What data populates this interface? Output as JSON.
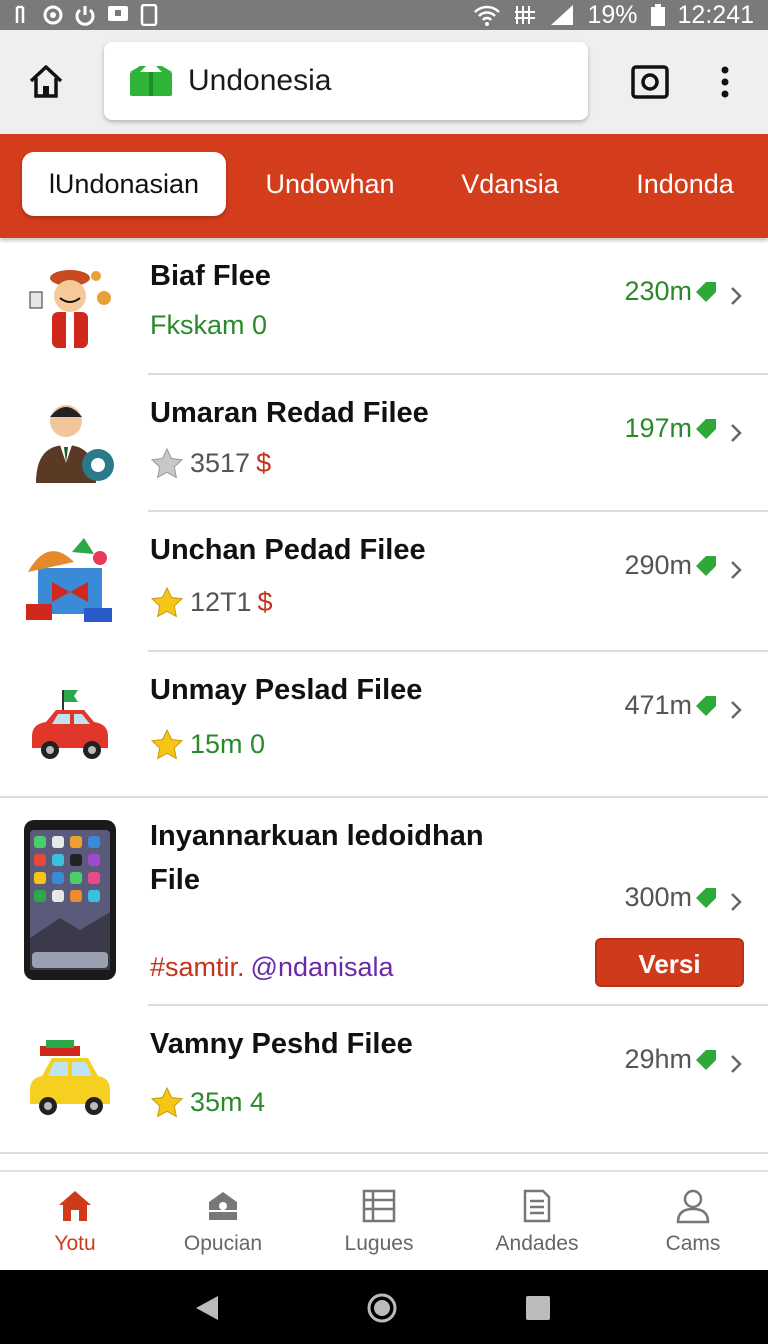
{
  "status_bar": {
    "battery": "19%",
    "time": "12:241"
  },
  "app_bar": {
    "url": "Undonesia"
  },
  "tabs": [
    {
      "label": "lUndonasian",
      "active": true
    },
    {
      "label": "Undowhan"
    },
    {
      "label": "Vdansia"
    },
    {
      "label": "Indonda"
    }
  ],
  "items": [
    {
      "title": "Biaf Flee",
      "sub_text": "Fkskam 0",
      "size": "230m"
    },
    {
      "title": "Umaran Redad Filee",
      "rating": "3517",
      "price": "$",
      "size": "197m"
    },
    {
      "title": "Unchan Pedad Filee",
      "rating": "12T1",
      "price": "$",
      "size": "290m"
    },
    {
      "title": "Unmay Peslad Filee",
      "rating": "15m 0",
      "size": "471m"
    },
    {
      "title_line1": "Inyannarkuan ledoidhan",
      "title_line2": "File",
      "tag1": "#samtir.",
      "tag2": "@ndanisala",
      "size": "300m",
      "button": "Versi"
    },
    {
      "title": "Vamny Peshd Filee",
      "rating": "35m 4",
      "size": "29hm"
    }
  ],
  "bottom_nav": [
    {
      "label": "Yotu",
      "icon": "home-icon",
      "active": true
    },
    {
      "label": "Opucian",
      "icon": "store-icon"
    },
    {
      "label": "Lugues",
      "icon": "list-icon"
    },
    {
      "label": "Andades",
      "icon": "document-icon"
    },
    {
      "label": "Cams",
      "icon": "person-icon"
    }
  ],
  "colors": {
    "accent": "#d43d1c",
    "green": "#2a8a2a",
    "button": "#cf3a1b"
  }
}
